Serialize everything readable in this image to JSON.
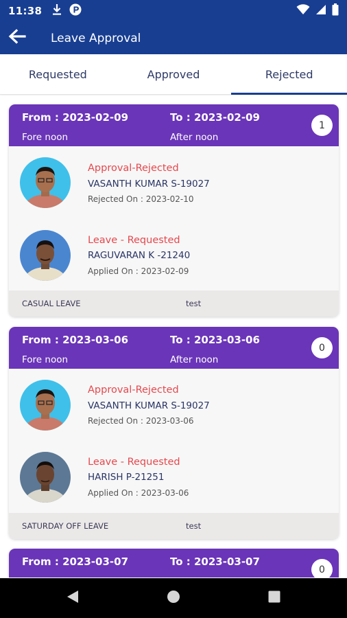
{
  "status_bar": {
    "time": "11:38",
    "left_icons": [
      "download-icon",
      "app-notification-icon"
    ],
    "right_icons": [
      "wifi-icon",
      "signal-icon",
      "battery-icon"
    ]
  },
  "app_bar": {
    "back_icon": "arrow-left-icon",
    "title": "Leave Approval",
    "color": "#183e92"
  },
  "tabs": [
    {
      "label": "Requested",
      "active": false
    },
    {
      "label": "Approved",
      "active": false
    },
    {
      "label": "Rejected",
      "active": true
    }
  ],
  "cards": [
    {
      "from": "From : 2023-02-09",
      "to": "To : 2023-02-09",
      "from_session": "Fore noon",
      "to_session": "After noon",
      "count": "1",
      "approver": {
        "status": "Approval-Rejected",
        "name": "VASANTH KUMAR S-19027",
        "date": "Rejected On : 2023-02-10"
      },
      "requester": {
        "status": "Leave - Requested",
        "name": "RAGUVARAN K -21240",
        "date": "Applied On : 2023-02-09"
      },
      "leave_type": "CASUAL LEAVE",
      "reason": "test"
    },
    {
      "from": "From : 2023-03-06",
      "to": "To : 2023-03-06",
      "from_session": "Fore noon",
      "to_session": "After noon",
      "count": "0",
      "approver": {
        "status": "Approval-Rejected",
        "name": "VASANTH KUMAR S-19027",
        "date": "Rejected On : 2023-03-06"
      },
      "requester": {
        "status": "Leave - Requested",
        "name": "HARISH P-21251",
        "date": "Applied On : 2023-03-06"
      },
      "leave_type": "SATURDAY OFF LEAVE",
      "reason": "test"
    },
    {
      "from": "From : 2023-03-07",
      "to": "To : 2023-03-07",
      "count": "0"
    }
  ],
  "nav_bar": {
    "icons": [
      "back-triangle-icon",
      "home-circle-icon",
      "recents-square-icon"
    ]
  },
  "colors": {
    "card_header": "#6a35b8",
    "status_text": "#e5484d",
    "name_text": "#2a3566"
  }
}
